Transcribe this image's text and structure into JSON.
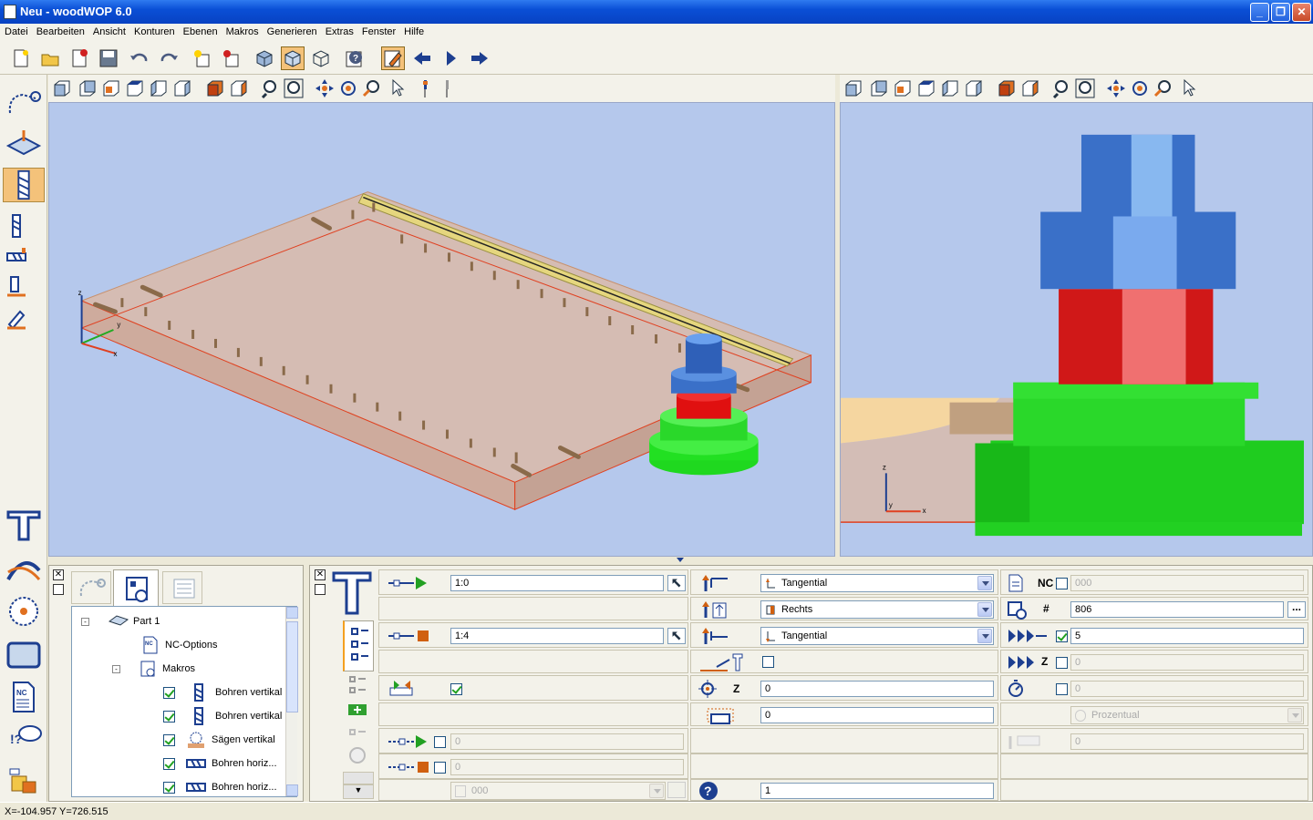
{
  "window": {
    "title": "Neu - woodWOP 6.0"
  },
  "menu": [
    "Datei",
    "Bearbeiten",
    "Ansicht",
    "Konturen",
    "Ebenen",
    "Makros",
    "Generieren",
    "Extras",
    "Fenster",
    "Hilfe"
  ],
  "tree": {
    "root": "Part 1",
    "nc_options": "NC-Options",
    "makros": "Makros",
    "items": [
      "Bohren vertikal",
      "Bohren vertikal",
      "Sägen vertikal",
      "Bohren horiz...",
      "Bohren horiz..."
    ]
  },
  "params": {
    "col1": {
      "row1_value": "1:0",
      "row3_value": "1:4",
      "row7_value": "0",
      "row8_value": "0",
      "row9_value": "000"
    },
    "col2": {
      "row1_select": "Tangential",
      "row2_select": "Rechts",
      "row3_select": "Tangential",
      "z_label": "Z",
      "row5_value": "0",
      "row6_value": "0",
      "row9_value": "1"
    },
    "col3": {
      "nc_label": "NC",
      "nc_value": "000",
      "hash_label": "#",
      "hash_value": "806",
      "more_label": "...",
      "row3_value": "5",
      "z_label": "Z",
      "row4_value": "0",
      "row5_value": "0",
      "row6_select": "Prozentual",
      "row7_value": "0"
    }
  },
  "status": {
    "coords": "X=-104.957 Y=726.515"
  },
  "colors": {
    "accent": "#f4c27a",
    "viewport_bg": "#b5c8ec",
    "titlebar": "#0a4fd6"
  }
}
